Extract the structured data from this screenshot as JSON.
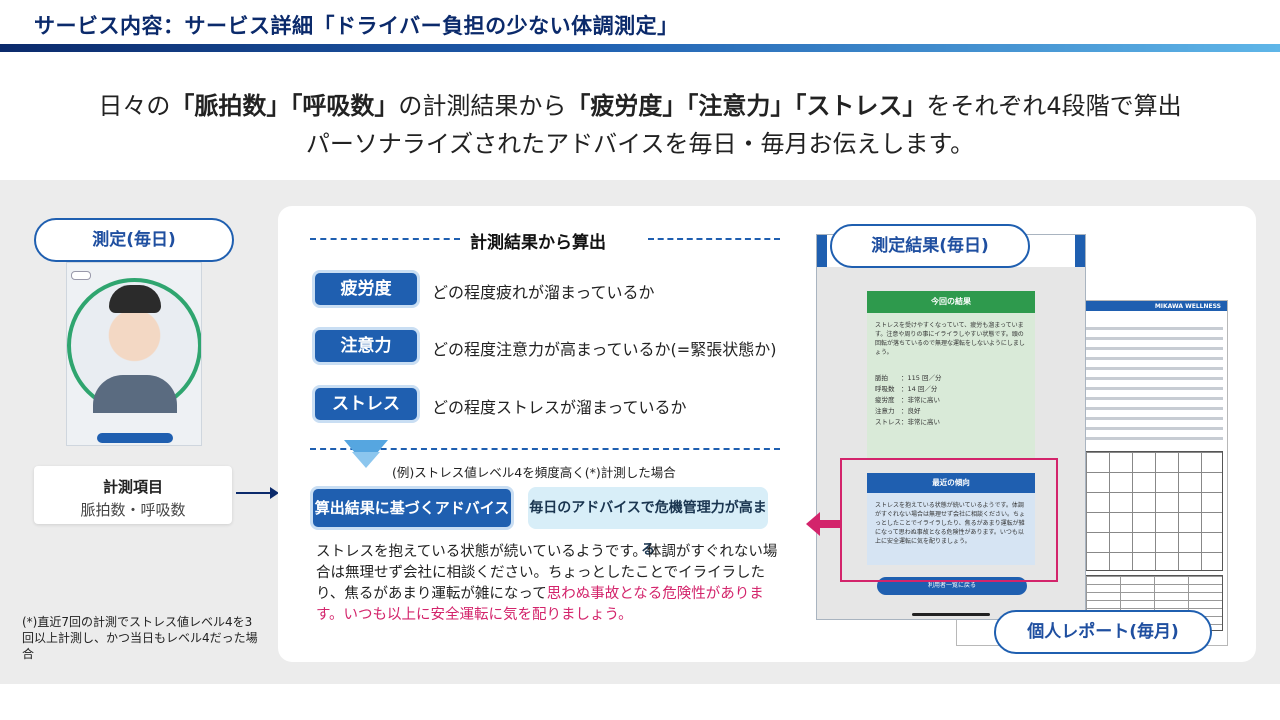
{
  "header": {
    "title": "サービス内容：サービス詳細「ドライバー負担の少ない体調測定」"
  },
  "headline": {
    "line1_pre": "日々の",
    "line1_bold1": "「脈拍数」「呼吸数」",
    "line1_mid": "の計測結果から",
    "line1_bold2": "「疲労度」「注意力」「ストレス」",
    "line1_post": "をそれぞれ4段階で算出",
    "line2": "パーソナライズされたアドバイスを毎日・毎月お伝えします。"
  },
  "left": {
    "measure_pill": "測定(毎日)",
    "items_title": "計測項目",
    "items_sub": "脈拍数・呼吸数",
    "footnote": "(*)直近7回の計測でストレス値レベル4を3回以上計測し、かつ当日もレベル4だった場合"
  },
  "calc": {
    "title": "計測結果から算出",
    "metrics": [
      {
        "label": "疲労度",
        "desc": "どの程度疲れが溜まっているか"
      },
      {
        "label": "注意力",
        "desc": "どの程度注意力が高まっているか(=緊張状態か)"
      },
      {
        "label": "ストレス",
        "desc": "どの程度ストレスが溜まっているか"
      }
    ],
    "example_note": "(例)ストレス値レベル4を頻度高く(*)計測した場合",
    "advice_chip": "算出結果に基づくアドバイス",
    "crisis_chip": "毎日のアドバイスで危機管理力が高まる",
    "advice_text_1": "ストレスを抱えている状態が続いているようです。体調がすぐれない場合は無理せず会社に相談ください。ちょっとしたことでイライラしたり、焦るがあまり運転が雑になって",
    "advice_text_warn": "思わぬ事故となる危険性があります。いつも以上に安全運転に気を配りましょう。"
  },
  "phone": {
    "result_pill": "測定結果(毎日)",
    "card1_title": "今回の結果",
    "card1_body": "ストレスを受けやすくなっていて、疲労も溜まっています。注意や周りの事にイライラしやすい状態です。頭の回転が落ちているので無理な運転をしないようにしましょう。",
    "stats": [
      "脈拍　　：115 回／分",
      "呼吸数　：14 回／分",
      "疲労度　：非常に高い",
      "注意力　：良好",
      "ストレス：非常に高い"
    ],
    "card2_title": "最近の傾向",
    "card2_body": "ストレスを抱えている状態が続いているようです。体調がすぐれない場合は無理せず会社に相談ください。ちょっとしたことでイライラしたり、焦るがあまり運転が雑になって思わぬ事故となる危険性があります。いつも以上に安全運転に気を配りましょう。",
    "button": "利用者一覧に戻る"
  },
  "report": {
    "logo": "MIKAWA WELLNESS",
    "pill": "個人レポート(毎月)"
  },
  "colors": {
    "brand_navy": "#0b2a6b",
    "brand_blue": "#1f5fb0",
    "accent_magenta": "#d3246b",
    "green": "#2e9a4d"
  }
}
